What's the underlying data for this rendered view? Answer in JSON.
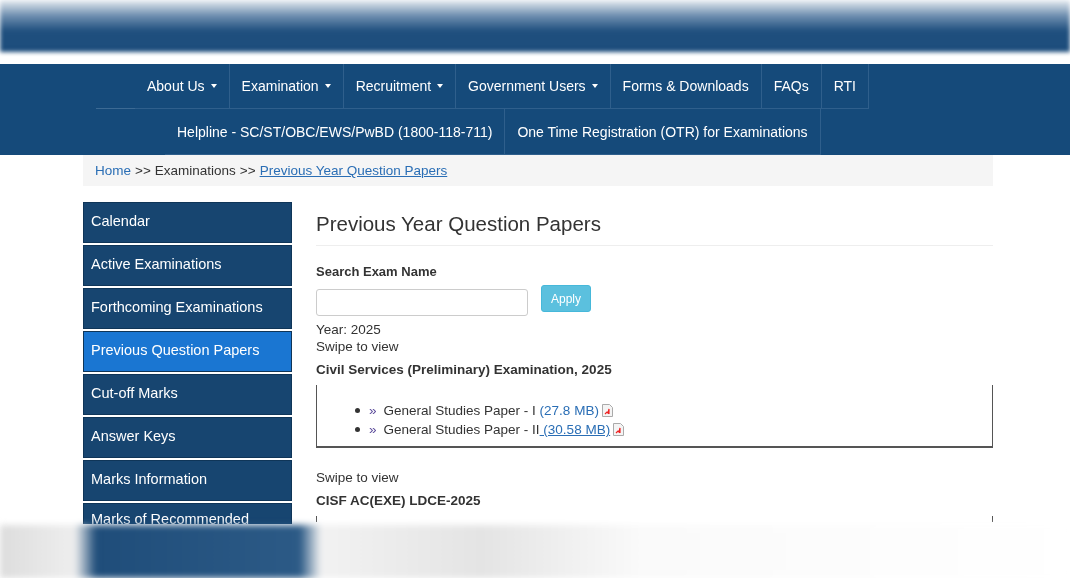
{
  "nav": {
    "primary": [
      {
        "label": "About Us",
        "has_menu": true
      },
      {
        "label": "Examination",
        "has_menu": true
      },
      {
        "label": "Recruitment",
        "has_menu": true
      },
      {
        "label": "Government Users",
        "has_menu": true
      },
      {
        "label": "Forms & Downloads",
        "has_menu": false
      },
      {
        "label": "FAQs",
        "has_menu": false
      },
      {
        "label": "RTI",
        "has_menu": false
      }
    ],
    "secondary": [
      {
        "label": "Helpline - SC/ST/OBC/EWS/PwBD (1800-118-711)"
      },
      {
        "label": "One Time Registration (OTR) for Examinations"
      }
    ]
  },
  "breadcrumb": [
    {
      "label": "Home",
      "kind": "link"
    },
    {
      "label": ">>",
      "kind": "separator"
    },
    {
      "label": "Examinations",
      "kind": "text"
    },
    {
      "label": ">>",
      "kind": "separator"
    },
    {
      "label": "Previous Year Question Papers",
      "kind": "current"
    }
  ],
  "sidebar": {
    "items": [
      {
        "label": "Calendar",
        "selected": false
      },
      {
        "label": "Active Examinations",
        "selected": false
      },
      {
        "label": "Forthcoming Examinations",
        "selected": false
      },
      {
        "label": "Previous Question Papers",
        "selected": true
      },
      {
        "label": "Cut-off Marks",
        "selected": false
      },
      {
        "label": "Answer Keys",
        "selected": false
      },
      {
        "label": "Marks Information",
        "selected": false
      },
      {
        "label": "Marks of Recommended",
        "selected": false
      }
    ]
  },
  "content": {
    "title": "Previous Year Question Papers",
    "search": {
      "label": "Search Exam Name",
      "button": "Apply"
    },
    "year": "Year: 2025",
    "exams": [
      {
        "hint": "Swipe to view",
        "name": "Civil Services (Preliminary) Examination, 2025",
        "papers": [
          {
            "bullet": "»",
            "name": "General Studies Paper - I",
            "size": " (27.8 MB)",
            "underlined": false
          },
          {
            "bullet": "»",
            "name": "General Studies Paper - II",
            "size": " (30.58 MB)",
            "underlined": true
          }
        ]
      },
      {
        "hint": "Swipe to view",
        "name": "CISF AC(EXE) LDCE-2025"
      }
    ]
  }
}
